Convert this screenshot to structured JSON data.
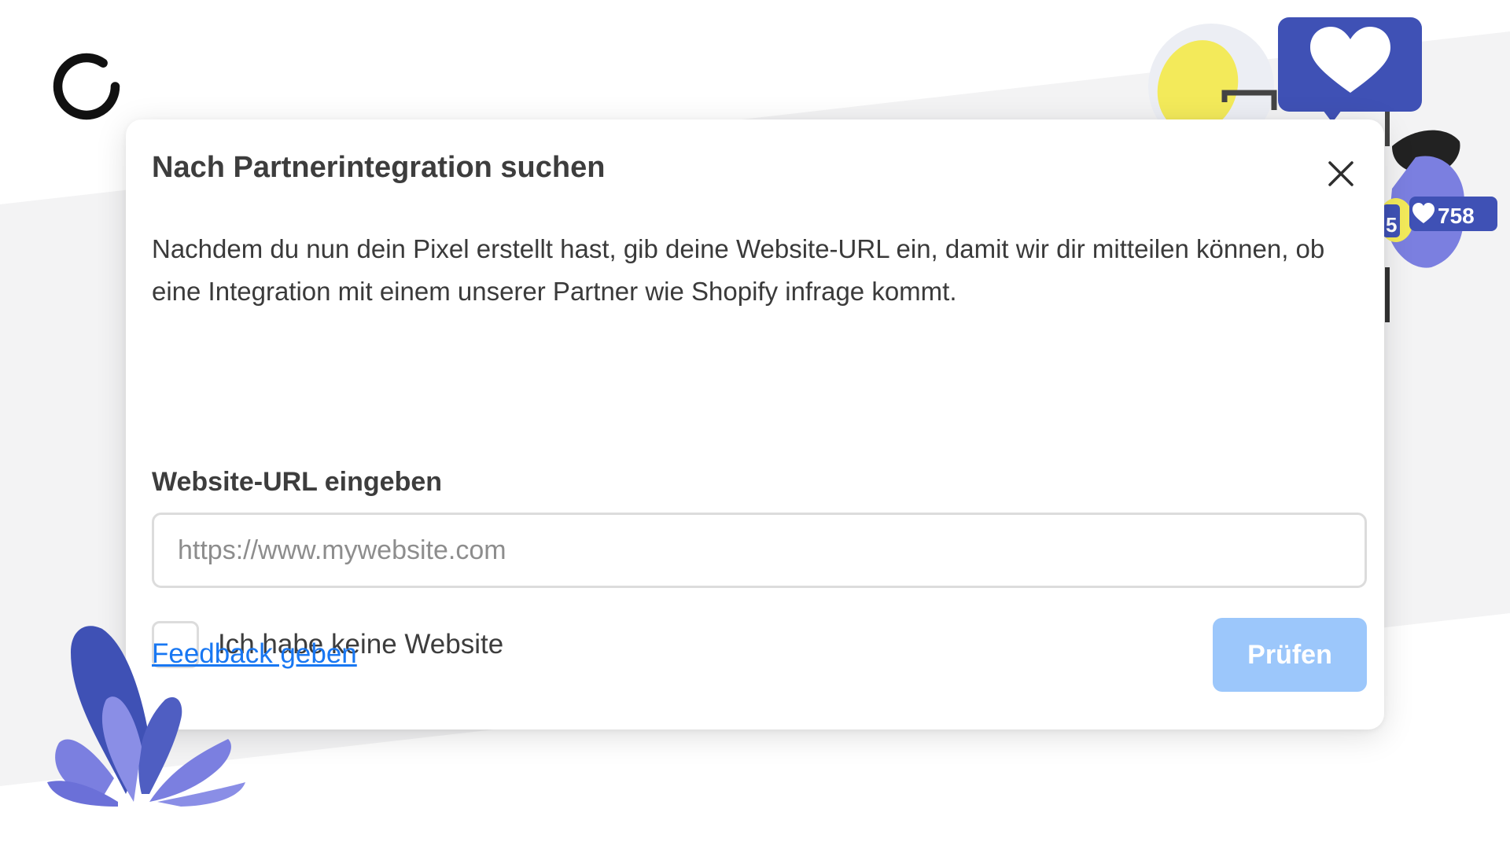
{
  "dialog": {
    "title": "Nach Partnerintegration suchen",
    "description": "Nachdem du nun dein Pixel erstellt hast, gib deine Website-URL ein, damit wir dir mitteilen können, ob eine Integration mit einem unserer Partner wie Shopify infrage kommt.",
    "url_field": {
      "label": "Website-URL eingeben",
      "placeholder": "https://www.mywebsite.com",
      "value": ""
    },
    "checkbox": {
      "label": "Ich habe keine Website",
      "checked": false
    },
    "feedback_link": "Feedback geben",
    "submit_label": "Prüfen",
    "submit_disabled": true
  },
  "decoration": {
    "like_count": "758",
    "partial_count": "5"
  },
  "colors": {
    "link": "#1877f2",
    "button_disabled": "#9cc7fb",
    "illustration_blue": "#3f51b5",
    "illustration_purple": "#7b7fe0",
    "illustration_yellow": "#f3ea5a"
  },
  "icons": {
    "close": "close-icon",
    "logo": "logo-ring-icon",
    "heart": "heart-icon"
  }
}
